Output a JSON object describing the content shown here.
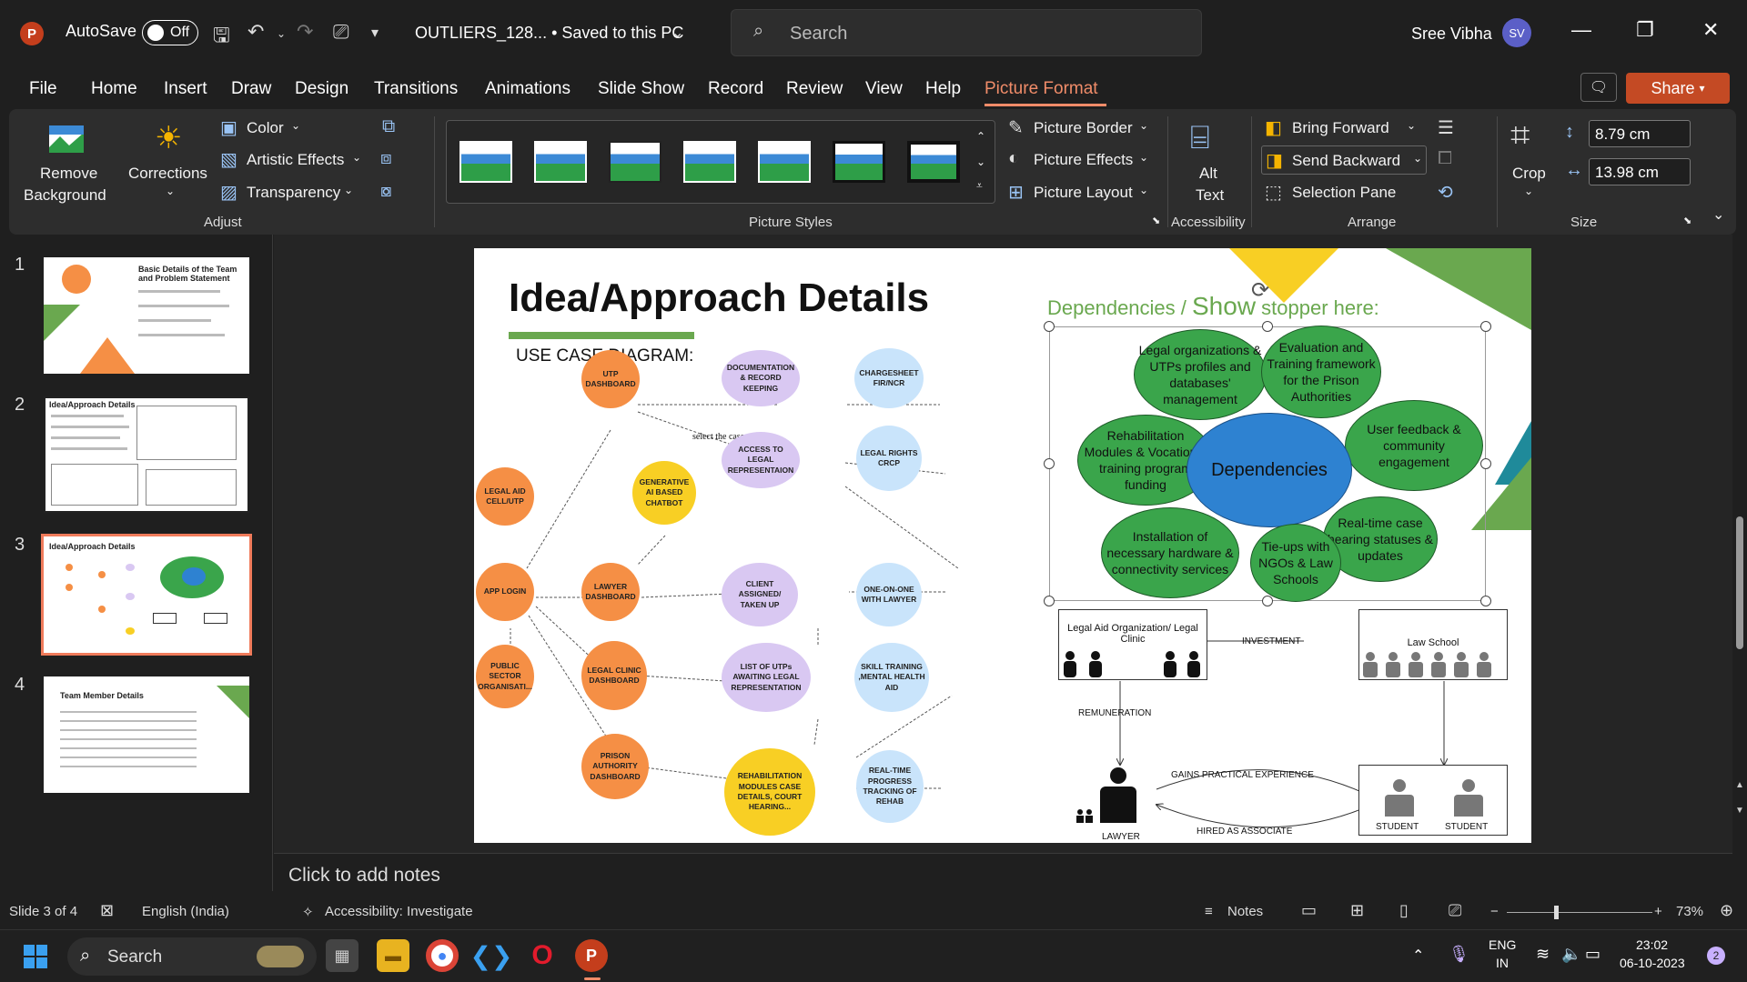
{
  "app": {
    "autosave_label": "AutoSave",
    "autosave_state": "Off",
    "doc_title": "OUTLIERS_128... • Saved to this PC",
    "search_placeholder": "Search",
    "user_name": "Sree Vibha",
    "user_initials": "SV",
    "share_label": "Share"
  },
  "menu": {
    "tabs": [
      "File",
      "Home",
      "Insert",
      "Draw",
      "Design",
      "Transitions",
      "Animations",
      "Slide Show",
      "Record",
      "Review",
      "View",
      "Help",
      "Picture Format"
    ],
    "active": "Picture Format"
  },
  "ribbon": {
    "remove_bg_line1": "Remove",
    "remove_bg_line2": "Background",
    "corrections": "Corrections",
    "color": "Color",
    "artistic_effects": "Artistic Effects",
    "transparency": "Transparency",
    "group_adjust": "Adjust",
    "group_picture_styles": "Picture Styles",
    "picture_border": "Picture Border",
    "picture_effects": "Picture Effects",
    "picture_layout": "Picture Layout",
    "alt_text_line1": "Alt",
    "alt_text_line2": "Text",
    "group_accessibility": "Accessibility",
    "bring_forward": "Bring Forward",
    "send_backward": "Send Backward",
    "selection_pane": "Selection Pane",
    "group_arrange": "Arrange",
    "crop": "Crop",
    "height_value": "8.79 cm",
    "width_value": "13.98 cm",
    "group_size": "Size"
  },
  "slides_panel": {
    "slides": [
      {
        "number": "1",
        "title": "Basic Details of the Team and Problem Statement"
      },
      {
        "number": "2",
        "title": "Idea/Approach Details"
      },
      {
        "number": "3",
        "title": "Idea/Approach Details"
      },
      {
        "number": "4",
        "title": "Team Member Details"
      }
    ],
    "selected": 3
  },
  "slide": {
    "title": "Idea/Approach Details",
    "use_case_label": "USE CASE DIAGRAM:",
    "select_case_type": "select the case type",
    "use_case_nodes": [
      "UTP DASHBOARD",
      "DOCUMENTATION & RECORD KEEPING",
      "CHARGESHEET FIR/NCR",
      "ACCESS TO LEGAL REPRESENTAION",
      "LEGAL RIGHTS CRCP",
      "LEGAL AID CELL/UTP",
      "GENERATIVE AI BASED CHATBOT",
      "APP LOGIN",
      "LAWYER DASHBOARD",
      "CLIENT ASSIGNED/ TAKEN UP",
      "ONE-ON-ONE WITH LAWYER",
      "PUBLIC SECTOR ORGANISATI...",
      "LEGAL CLINIC DASHBOARD",
      "LIST OF UTPs AWAITING LEGAL REPRESENTATION",
      "SKILL TRAINING ,MENTAL HEALTH AID",
      "PRISON AUTHORITY DASHBOARD",
      "REHABILITATION MODULES CASE DETAILS, COURT HEARING...",
      "REAL-TIME PROGRESS TRACKING OF REHAB"
    ],
    "dependencies_title_a": "Dependencies / ",
    "dependencies_title_b": "Show",
    "dependencies_title_c": " stopper here:",
    "dependency_center": "Dependencies",
    "dependency_items": [
      "Legal organizations & UTPs profiles and databases' management",
      "Evaluation and Training framework for the Prison Authorities",
      "Rehabilitation Modules & Vocational training program funding",
      "User feedback & community engagement",
      "Real-time case hearing statuses & updates",
      "Installation of necessary hardware & connectivity services",
      "Tie-ups with NGOs & Law Schools"
    ],
    "flow": {
      "legal_aid_org": "Legal Aid Organization/ Legal Clinic",
      "investment": "INVESTMENT",
      "law_school": "Law School",
      "remuneration": "REMUNERATION",
      "gains": "GAINS PRACTICAL EXPERIENCE",
      "hired": "HIRED AS ASSOCIATE",
      "lawyer": "LAWYER",
      "student1": "STUDENT",
      "student2": "STUDENT"
    }
  },
  "notes_placeholder": "Click to add notes",
  "status": {
    "slide_count": "Slide 3 of 4",
    "language": "English (India)",
    "accessibility": "Accessibility: Investigate",
    "notes": "Notes",
    "zoom": "73%"
  },
  "taskbar": {
    "search": "Search",
    "lang1": "ENG",
    "lang2": "IN",
    "time": "23:02",
    "date": "06-10-2023",
    "badge": "2"
  }
}
